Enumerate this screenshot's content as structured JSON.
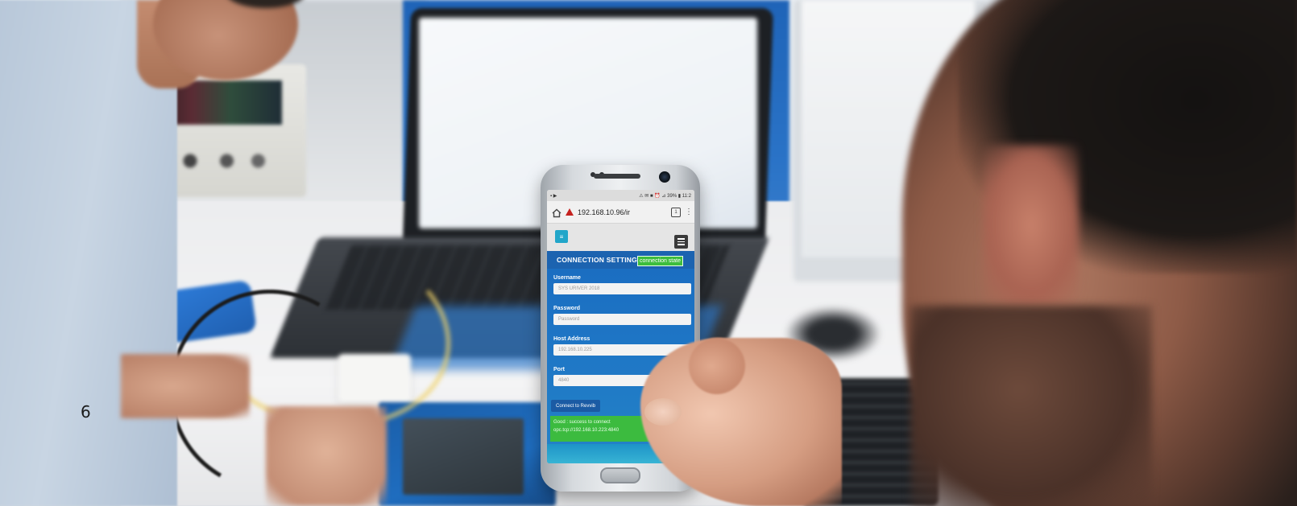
{
  "page": {
    "number": "6"
  },
  "phone": {
    "status_bar_left": "▪ ▶",
    "status_bar_right": "⚠ ✉ ■ ⏰ ⊿ 39% ▮ 11:2",
    "url": "192.168.10.96/ir",
    "tabs_count": "1",
    "app": {
      "logo_glyph": "≡",
      "panel_title": "CONNECTION SETTINGS",
      "connection_badge": "connection state",
      "fields": [
        {
          "label": "Username",
          "value": "SYS URIVER 2018"
        },
        {
          "label": "Password",
          "value": "Password"
        },
        {
          "label": "Host Address",
          "value": "192.168.10.225"
        },
        {
          "label": "Port",
          "value": "4840"
        }
      ],
      "connect_button": "Connect to Revvib",
      "success_line1": "Good : success to connect",
      "success_line2": "opc.tcp://192.168.10.223:4840"
    }
  },
  "colors": {
    "panel_blue": "#1f77c6",
    "success_green": "#3cbb3f",
    "warning_red": "#c5221f",
    "logo_teal": "#22a6c9"
  }
}
